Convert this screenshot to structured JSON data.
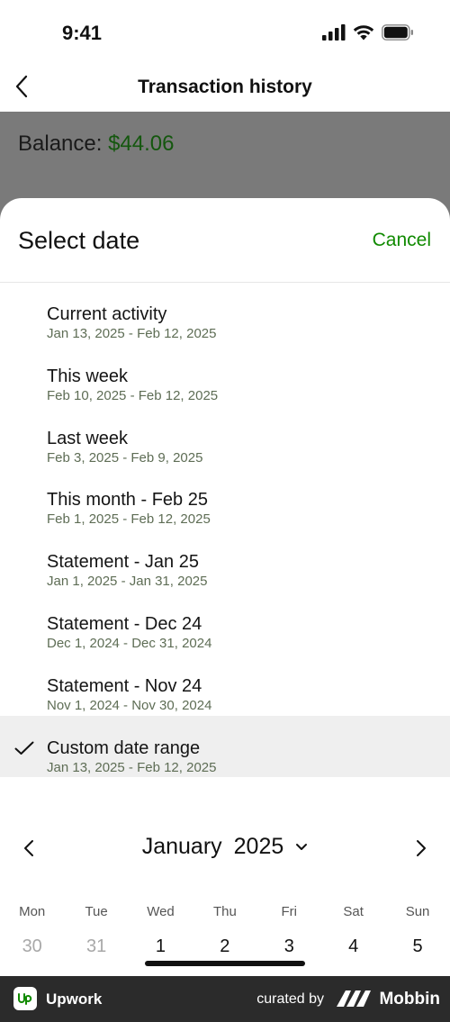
{
  "status_bar": {
    "time": "9:41",
    "icons": [
      "cellular-signal-icon",
      "wifi-icon",
      "battery-icon"
    ]
  },
  "nav": {
    "title": "Transaction history",
    "back_icon": "chevron-left-icon"
  },
  "balance": {
    "label": "Balance:",
    "amount": "$44.06"
  },
  "sheet": {
    "title": "Select date",
    "cancel_label": "Cancel",
    "options": [
      {
        "label": "Current activity",
        "range": "Jan 13, 2025 - Feb 12, 2025",
        "selected": false
      },
      {
        "label": "This week",
        "range": "Feb 10, 2025 - Feb 12, 2025",
        "selected": false
      },
      {
        "label": "Last week",
        "range": "Feb 3, 2025 - Feb 9, 2025",
        "selected": false
      },
      {
        "label": "This month - Feb 25",
        "range": "Feb 1, 2025 - Feb 12, 2025",
        "selected": false
      },
      {
        "label": "Statement - Jan 25",
        "range": "Jan 1, 2025 - Jan 31, 2025",
        "selected": false
      },
      {
        "label": "Statement - Dec 24",
        "range": "Dec 1, 2024 - Dec 31, 2024",
        "selected": false
      },
      {
        "label": "Statement - Nov 24",
        "range": "Nov 1, 2024 - Nov 30, 2024",
        "selected": false
      },
      {
        "label": "Custom date range",
        "range": "Jan 13, 2025 - Feb 12, 2025",
        "selected": true
      }
    ]
  },
  "calendar": {
    "month": "January",
    "year": "2025",
    "weekdays": [
      "Mon",
      "Tue",
      "Wed",
      "Thu",
      "Fri",
      "Sat",
      "Sun"
    ],
    "first_row": [
      {
        "day": "30",
        "muted": true
      },
      {
        "day": "31",
        "muted": true
      },
      {
        "day": "1",
        "muted": false
      },
      {
        "day": "2",
        "muted": false
      },
      {
        "day": "3",
        "muted": false
      },
      {
        "day": "4",
        "muted": false
      },
      {
        "day": "5",
        "muted": false
      }
    ]
  },
  "footer": {
    "brand": "Upwork",
    "curated_by": "curated by",
    "mobbin": "Mobbin"
  },
  "colors": {
    "accent_green": "#108a00",
    "balance_green": "#14570e",
    "overlay_gray": "#7a7a7a",
    "selected_bg": "#efefef"
  }
}
